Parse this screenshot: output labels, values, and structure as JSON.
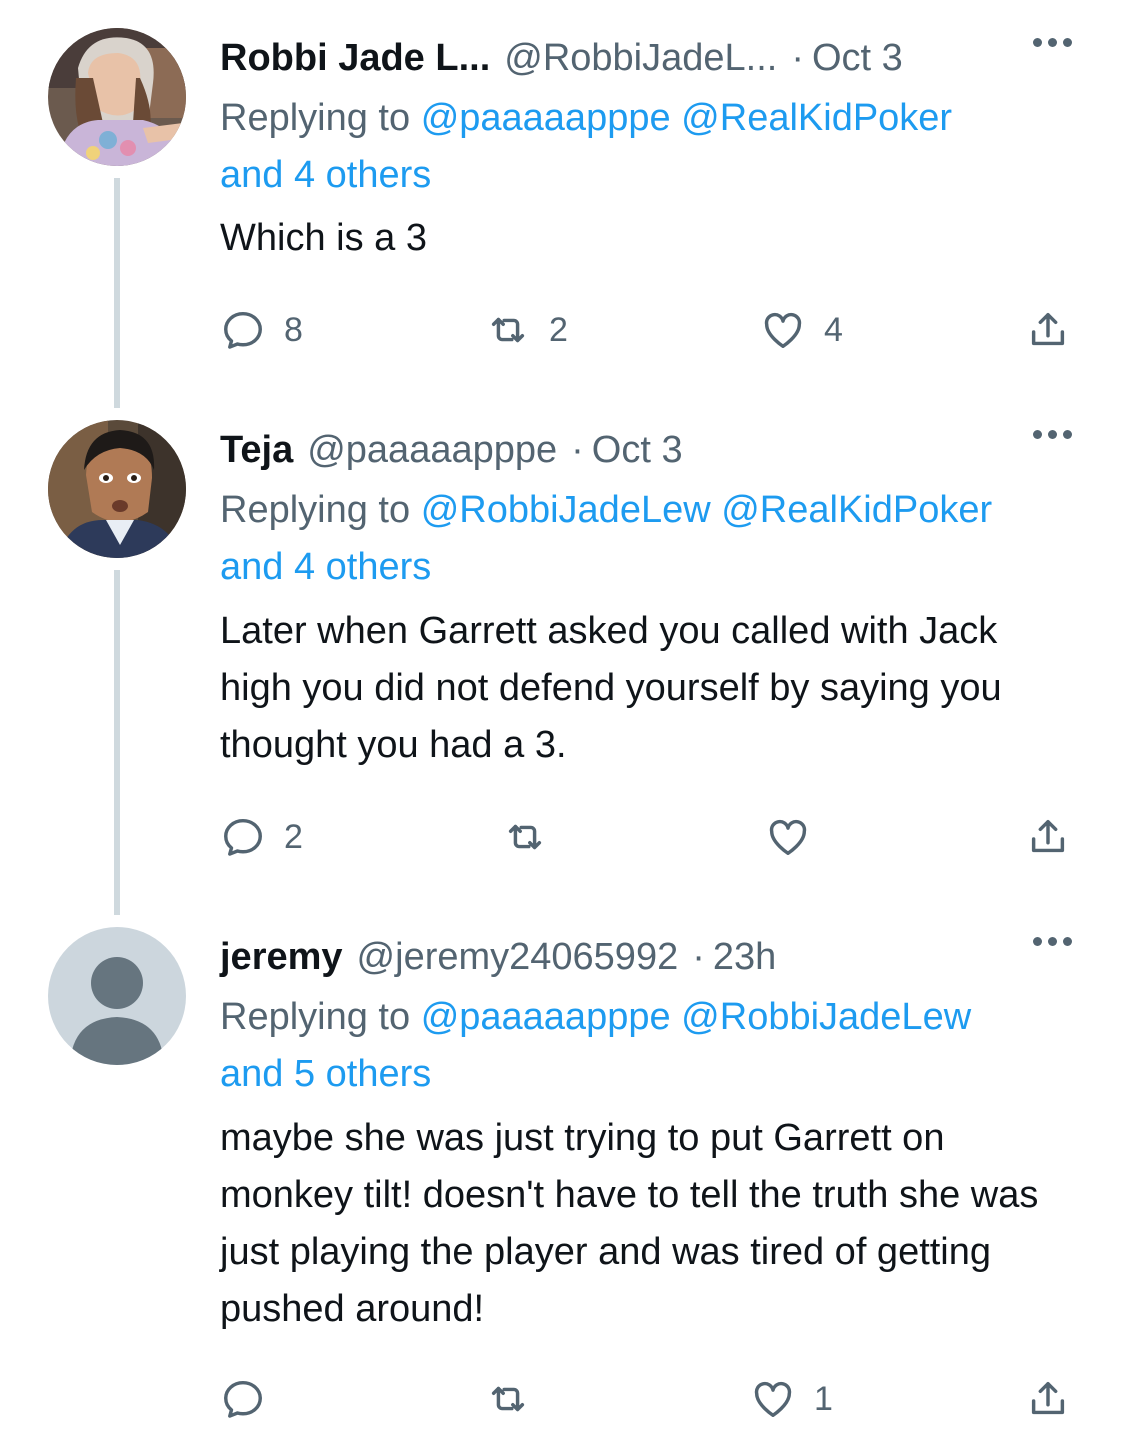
{
  "tweets": [
    {
      "name": "Robbi Jade L...",
      "handle": "@RobbiJadeL...",
      "separator": "·",
      "time": "Oct 3",
      "replying_prefix": "Replying to",
      "replying_mentions": [
        "@paaaaapppe",
        "@RealKidPoker"
      ],
      "replying_others": "and 4 others",
      "body": "Which is a 3",
      "replies": "8",
      "retweets": "2",
      "likes": "4",
      "avatar": "photo-woman-avatar"
    },
    {
      "name": "Teja",
      "handle": "@paaaaapppe",
      "separator": "·",
      "time": "Oct 3",
      "replying_prefix": "Replying to",
      "replying_mentions": [
        "@RobbiJadeLew",
        "@RealKidPoker"
      ],
      "replying_others": "and 4 others",
      "body": "Later when Garrett asked you called with Jack high you did not defend yourself by saying you thought you had a 3.",
      "replies": "2",
      "retweets": "",
      "likes": "",
      "avatar": "photo-man-avatar"
    },
    {
      "name": "jeremy",
      "handle": "@jeremy24065992",
      "separator": "·",
      "time": "23h",
      "replying_prefix": "Replying to",
      "replying_mentions": [
        "@paaaaapppe",
        "@RobbiJadeLew"
      ],
      "replying_others": "and 5 others",
      "body": "maybe she was just trying to put Garrett on monkey tilt! doesn't have to tell the truth she was just playing the player and was tired of getting pushed around!",
      "replies": "",
      "retweets": "",
      "likes": "1",
      "avatar": "default-avatar"
    }
  ],
  "colors": {
    "text": "#0f1419",
    "secondary": "#536471",
    "link": "#1d9bf0",
    "thread_line": "#cfd9de"
  }
}
